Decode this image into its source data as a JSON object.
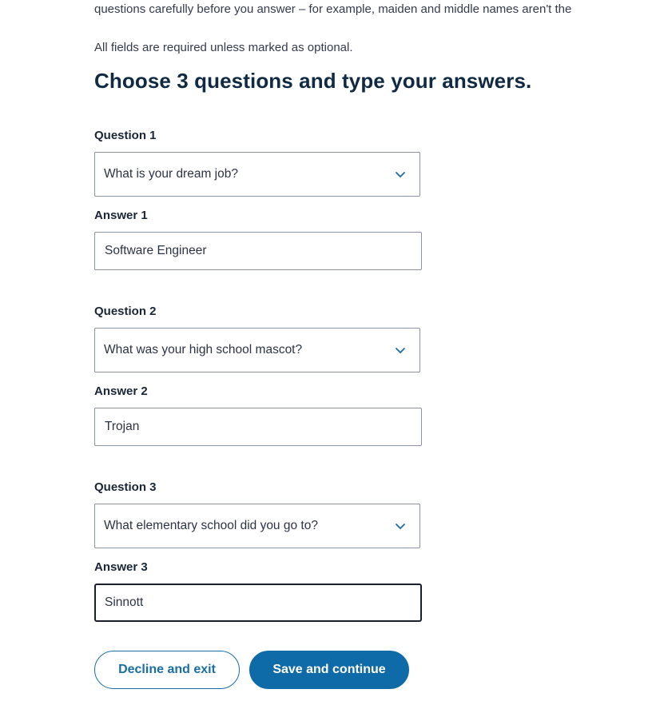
{
  "intro": {
    "text": "questions carefully before you answer – for example, maiden and middle names aren't the",
    "required_note": "All fields are required unless marked as optional."
  },
  "page_title": "Choose 3 questions and type your answers.",
  "questions": [
    {
      "question_label": "Question 1",
      "selected_question": "What is your dream job?",
      "answer_label": "Answer 1",
      "answer_value": "Software Engineer"
    },
    {
      "question_label": "Question 2",
      "selected_question": "What was your high school mascot?",
      "answer_label": "Answer 2",
      "answer_value": "Trojan"
    },
    {
      "question_label": "Question 3",
      "selected_question": "What elementary school did you go to?",
      "answer_label": "Answer 3",
      "answer_value": "Sinnott"
    }
  ],
  "actions": {
    "decline_label": "Decline and exit",
    "save_label": "Save and continue"
  },
  "icons": {
    "select_chevron": "chevron-down-icon"
  },
  "colors": {
    "primary": "#0f6ba8",
    "title": "#102a43",
    "border": "#8a94a3"
  }
}
